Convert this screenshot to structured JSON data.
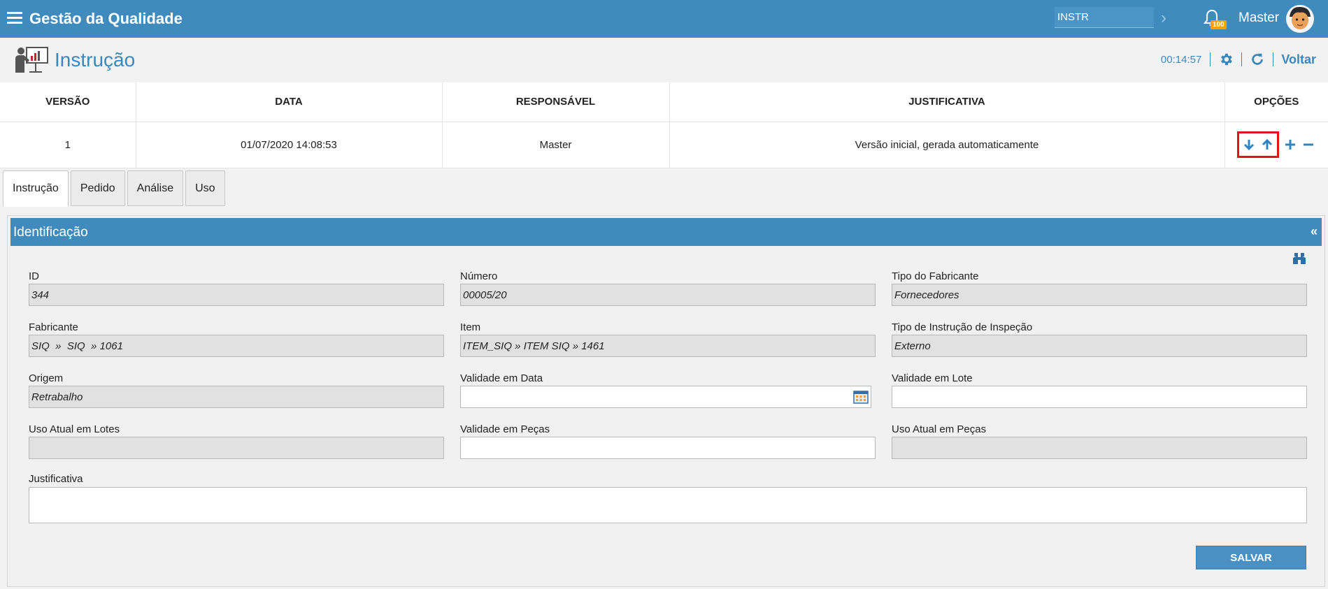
{
  "app": {
    "title": "Gestão da Qualidade",
    "search_value": "INSTR",
    "notification_count": "100",
    "user_name": "Master"
  },
  "page": {
    "title": "Instrução",
    "timer": "00:14:57",
    "back_label": "Voltar"
  },
  "versions": {
    "headers": [
      "VERSÃO",
      "DATA",
      "RESPONSÁVEL",
      "JUSTIFICATIVA",
      "OPÇÕES"
    ],
    "rows": [
      {
        "version": "1",
        "date": "01/07/2020 14:08:53",
        "responsible": "Master",
        "justification": "Versão inicial, gerada automaticamente"
      }
    ]
  },
  "tabs": [
    "Instrução",
    "Pedido",
    "Análise",
    "Uso"
  ],
  "panel": {
    "title": "Identificação",
    "collapse_symbol": "«"
  },
  "fields": {
    "id": {
      "label": "ID",
      "value": "344"
    },
    "numero": {
      "label": "Número",
      "value": "00005/20"
    },
    "tipo_fabricante": {
      "label": "Tipo do Fabricante",
      "value": "Fornecedores"
    },
    "fabricante": {
      "label": "Fabricante",
      "value": "SIQ  »  SIQ  » 1061"
    },
    "item": {
      "label": "Item",
      "value": "ITEM_SIQ » ITEM SIQ » 1461"
    },
    "tipo_instrucao": {
      "label": "Tipo de Instrução de Inspeção",
      "value": "Externo"
    },
    "origem": {
      "label": "Origem",
      "value": "Retrabalho"
    },
    "validade_data": {
      "label": "Validade em Data",
      "value": ""
    },
    "validade_lote": {
      "label": "Validade em Lote",
      "value": ""
    },
    "uso_lotes": {
      "label": "Uso Atual em Lotes",
      "value": ""
    },
    "validade_pecas": {
      "label": "Validade em Peças",
      "value": ""
    },
    "uso_pecas": {
      "label": "Uso Atual em Peças",
      "value": ""
    },
    "justificativa": {
      "label": "Justificativa",
      "value": ""
    }
  },
  "save_label": "SALVAR",
  "colors": {
    "primary": "#3f8bbd",
    "highlight_box": "#e0141c",
    "badge": "#f3a200"
  }
}
